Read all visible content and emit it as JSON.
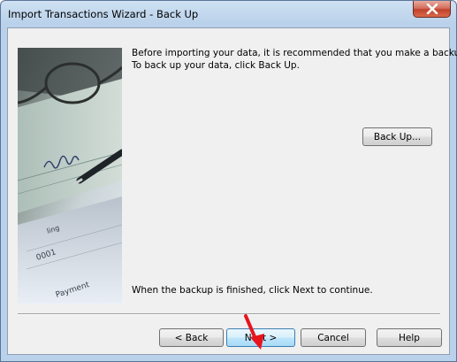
{
  "window": {
    "title": "Import Transactions Wizard - Back Up",
    "close_icon": "close-icon"
  },
  "content": {
    "intro_line1": "Before importing your data, it is recommended that you make a backup.",
    "intro_line2": "To back up your data, click Back Up.",
    "backup_button": "Back Up...",
    "finish_text": "When the backup is finished, click Next to continue."
  },
  "image": {
    "check_text_ling": "ling",
    "check_text_number": "0001",
    "check_text_payment": "Payment"
  },
  "footer": {
    "back_label": "< Back",
    "next_label": "Next >",
    "cancel_label": "Cancel",
    "help_label": "Help"
  },
  "colors": {
    "title_gradient_top": "#cfe1f3",
    "client_bg": "#f0f0f0",
    "close_red": "#c2422c",
    "default_button": "#3c7fb1",
    "annotation_arrow": "#e8141c"
  },
  "annotation": {
    "arrow_icon": "red-arrow-icon"
  }
}
